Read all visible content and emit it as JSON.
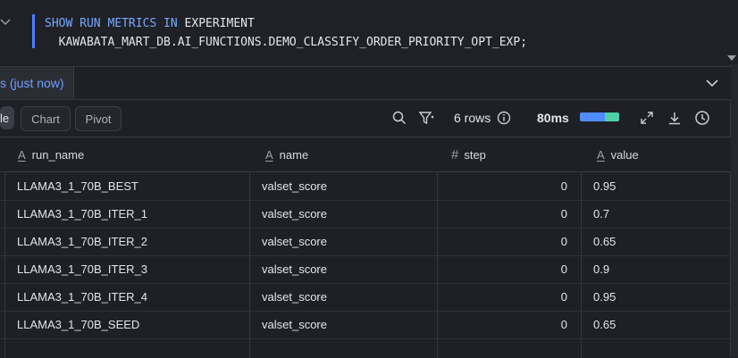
{
  "editor": {
    "line1": [
      {
        "t": "SHOW RUN METRICS IN ",
        "kind": "kw"
      },
      {
        "t": "EXPERIMENT",
        "kind": "id"
      }
    ],
    "line2": "  KAWABATA_MART_DB.AI_FUNCTIONS.DEMO_CLASSIFY_ORDER_PRIORITY_OPT_EXP;"
  },
  "results": {
    "tab_label": "s (just now)"
  },
  "toolbar": {
    "view_tabs": [
      "le",
      "Chart",
      "Pivot"
    ],
    "rows_count": "6 rows",
    "duration": "80ms",
    "icons": [
      "search-icon",
      "filter-icon",
      "info-icon",
      "expand-icon",
      "download-icon",
      "history-icon"
    ]
  },
  "table": {
    "columns": [
      {
        "label": "run_name",
        "type_icon": "A"
      },
      {
        "label": "name",
        "type_icon": "A"
      },
      {
        "label": "step",
        "type_icon": "#"
      },
      {
        "label": "value",
        "type_icon": "A"
      }
    ],
    "rows": [
      [
        "LLAMA3_1_70B_BEST",
        "valset_score",
        "0",
        "0.95"
      ],
      [
        "LLAMA3_1_70B_ITER_1",
        "valset_score",
        "0",
        "0.7"
      ],
      [
        "LLAMA3_1_70B_ITER_2",
        "valset_score",
        "0",
        "0.65"
      ],
      [
        "LLAMA3_1_70B_ITER_3",
        "valset_score",
        "0",
        "0.9"
      ],
      [
        "LLAMA3_1_70B_ITER_4",
        "valset_score",
        "0",
        "0.95"
      ],
      [
        "LLAMA3_1_70B_SEED",
        "valset_score",
        "0",
        "0.65"
      ]
    ]
  },
  "colors": {
    "accent": "#4f7cff",
    "keyword": "#78a8ff",
    "bar_primary": "#4f8cff",
    "bar_secondary": "#4fd1a5"
  }
}
